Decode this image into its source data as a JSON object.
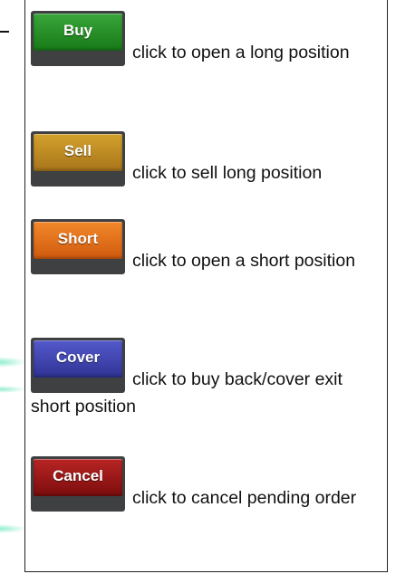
{
  "buttons": [
    {
      "label": "Buy",
      "description": "click to open a long position",
      "color": "#1f8a1f"
    },
    {
      "label": "Sell",
      "description": "click to sell long position",
      "color": "#b8861f"
    },
    {
      "label": "Short",
      "description": "click to open a short position",
      "color": "#e5701a"
    },
    {
      "label": "Cover",
      "description": "click to buy back/cover exit short position",
      "color": "#3e43b0"
    },
    {
      "label": "Cancel",
      "description": "click to cancel pending order",
      "color": "#9a1414"
    }
  ]
}
